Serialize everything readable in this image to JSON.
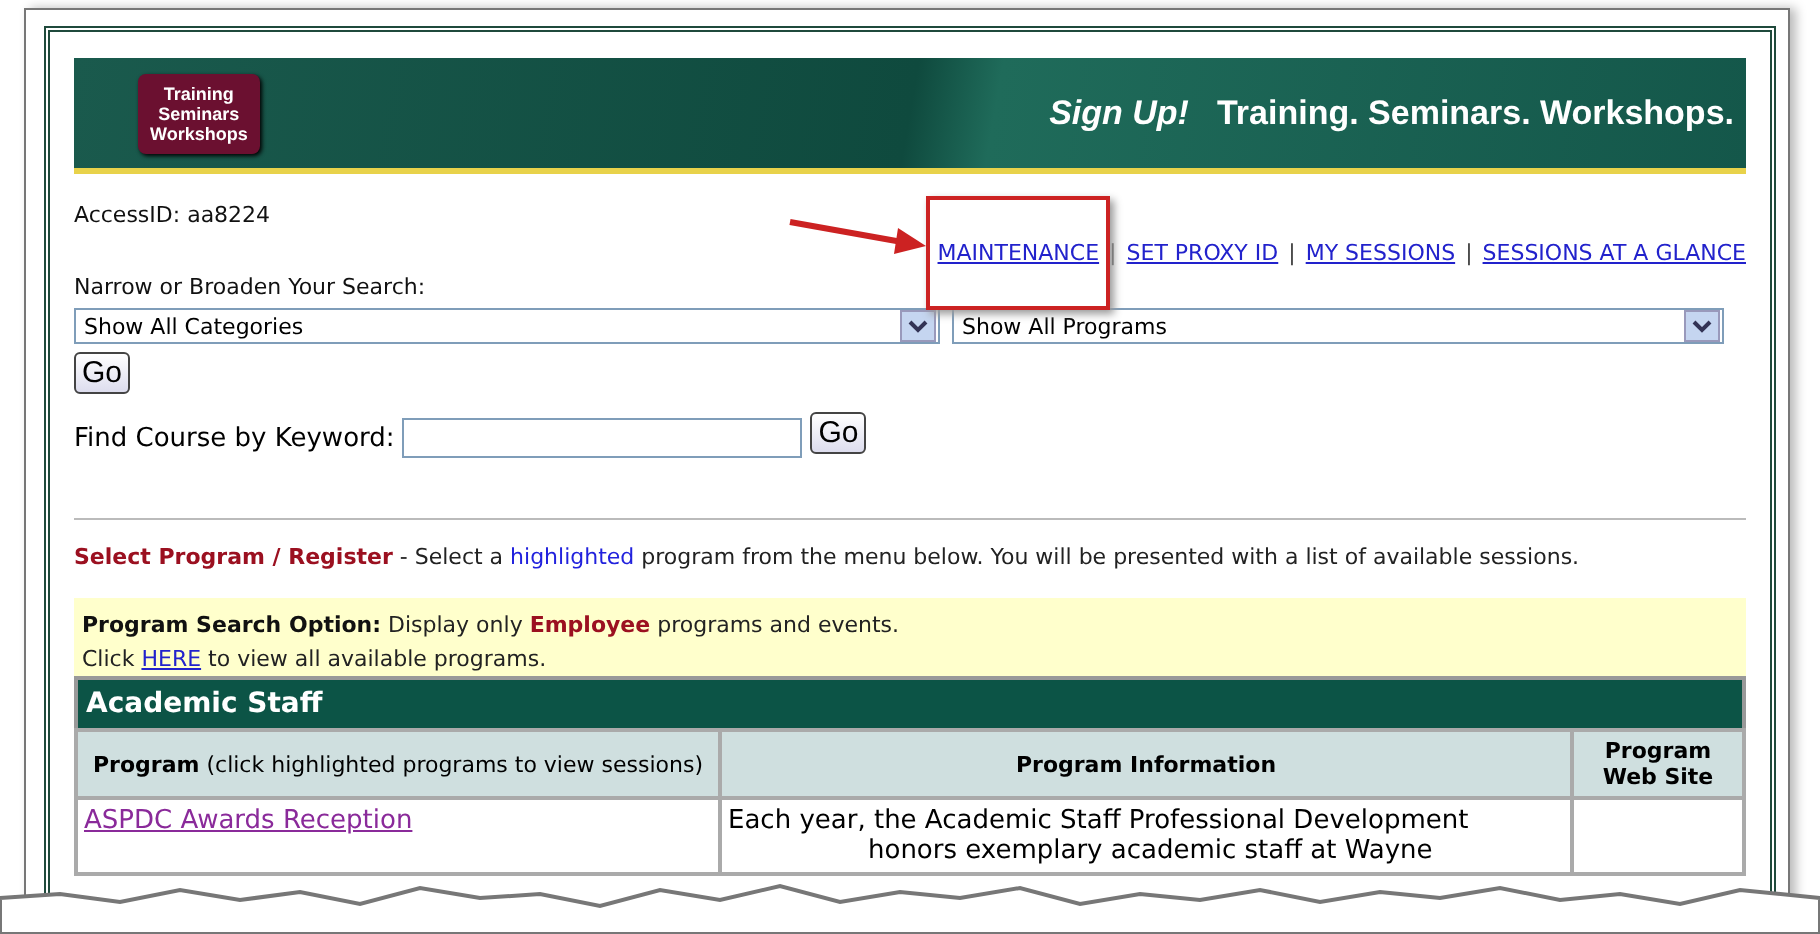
{
  "banner": {
    "logo_lines": [
      "Training",
      "Seminars",
      "Workshops"
    ],
    "tagline_lead": "Sign Up!",
    "tagline": "Training. Seminars. Workshops."
  },
  "access_id": "AccessID: aa8224",
  "nav_links": [
    {
      "label": "MAINTENANCE",
      "callout": true
    },
    {
      "label": "SET PROXY ID",
      "callout": false
    },
    {
      "label": "MY SESSIONS",
      "callout": false
    },
    {
      "label": "SESSIONS AT A GLANCE",
      "callout": false
    }
  ],
  "nav_separator": "|",
  "search": {
    "label": "Narrow or Broaden Your Search:",
    "category_select": "Show All Categories",
    "program_select": "Show All Programs",
    "go": "Go"
  },
  "keyword": {
    "label": "Find Course by Keyword:",
    "go": "Go"
  },
  "instructions": [
    {
      "text": "Select Program / Register",
      "kind": "heading"
    },
    {
      "text": " - Select a ",
      "kind": "plain"
    },
    {
      "text": "highlighted",
      "kind": "highlight"
    },
    {
      "text": " program from the menu below. You will be presented with a list of available sessions.",
      "kind": "plain"
    }
  ],
  "search_option": [
    [
      {
        "text": "Program Search Option:",
        "kind": "bold"
      },
      {
        "text": " Display only ",
        "kind": "plain"
      },
      {
        "text": "Employee",
        "kind": "heading"
      },
      {
        "text": " programs and events.",
        "kind": "plain"
      }
    ],
    [
      {
        "text": "Click ",
        "kind": "plain"
      },
      {
        "text": "HERE",
        "kind": "link"
      },
      {
        "text": " to view all available programs.",
        "kind": "plain"
      }
    ]
  ],
  "table": {
    "title": "Academic Staff",
    "columns": [
      {
        "label": "Program",
        "note": "(click highlighted programs to view sessions)"
      },
      {
        "label": "Program Information"
      },
      {
        "label": "Program Web Site"
      }
    ],
    "rows": [
      {
        "program": "ASPDC Awards Reception",
        "information": [
          "Each year, the Academic Staff Professional Development",
          "honors exemplary academic staff at Wayne"
        ]
      }
    ]
  }
}
